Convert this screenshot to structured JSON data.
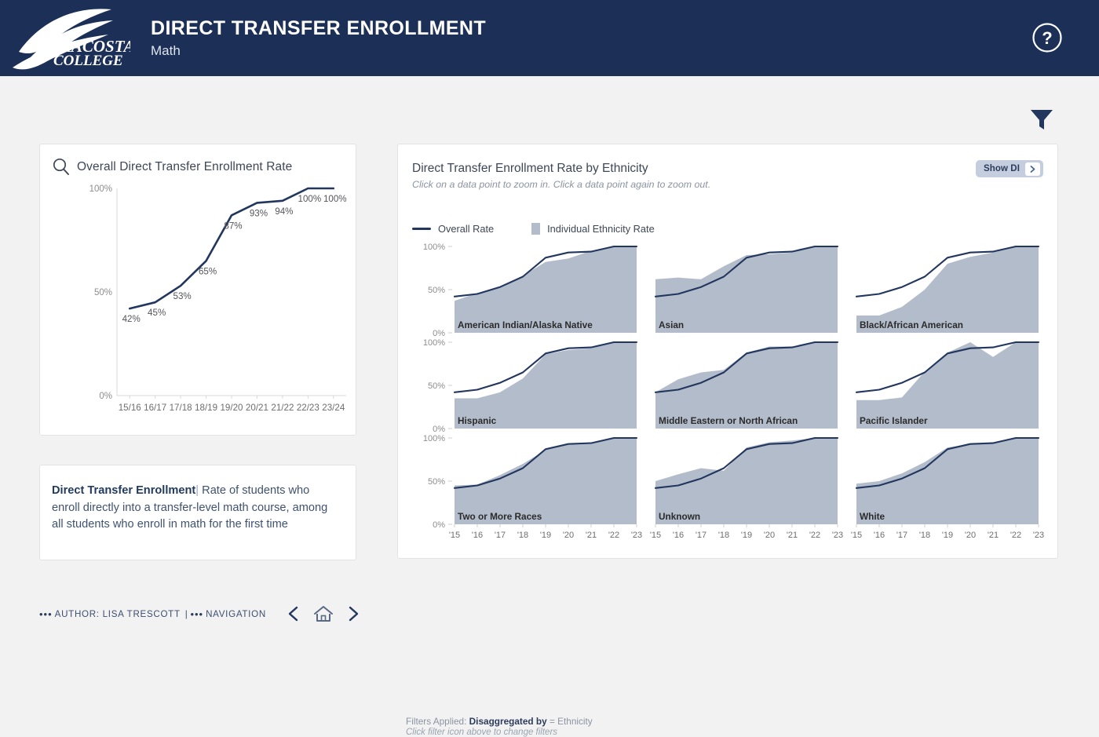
{
  "header": {
    "logo_text_line1": "MIRACOSTA",
    "logo_text_line2": "COLLEGE",
    "title": "DIRECT TRANSFER ENROLLMENT",
    "subtitle": "Math",
    "help_icon": "help-circle-icon",
    "bg_color": "#1b2f57"
  },
  "toolbar": {
    "filter_icon": "filter-funnel-icon"
  },
  "overall_card": {
    "search_icon": "magnifier-icon",
    "title": "Overall Direct Transfer Enrollment Rate"
  },
  "description": {
    "bold": "Direct Transfer Enrollment",
    "pipe": "|",
    "text": "Rate of students who enroll directly into a transfer-level math course, among all students who enroll in math for the first time"
  },
  "ethnicity_card": {
    "title": "Direct Transfer Enrollment Rate by Ethnicity",
    "subtitle": "Click on a data point to zoom in. Click a data point again to zoom out.",
    "show_di_label": "Show DI",
    "show_di_icon": "chevron-right-icon",
    "legend": [
      {
        "type": "line",
        "label": "Overall Rate",
        "color": "#22365e"
      },
      {
        "type": "area",
        "label": "Individual Ethnicity Rate",
        "color": "#b3bcca"
      }
    ],
    "filters_label": "Filters Applied:",
    "filters_key": "Disaggregated by",
    "filters_eq": "=",
    "filters_value": "Ethnicity",
    "filters_hint": "Click filter icon above to change filters"
  },
  "footer": {
    "author": "AUTHOR: LISA TRESCOTT",
    "separator": "|",
    "navigation": "NAVIGATION",
    "prev_icon": "chevron-left-icon",
    "home_icon": "home-icon",
    "next_icon": "chevron-right-icon"
  },
  "chart_data": [
    {
      "type": "line",
      "id": "overall",
      "title": "Overall Direct Transfer Enrollment Rate",
      "xlabel": "",
      "ylabel": "",
      "ylim": [
        0,
        100
      ],
      "yticks": [
        "0%",
        "50%",
        "100%"
      ],
      "ytick_values": [
        0,
        50,
        100
      ],
      "categories": [
        "15/16",
        "16/17",
        "17/18",
        "18/19",
        "19/20",
        "20/21",
        "21/22",
        "22/23",
        "23/24"
      ],
      "values": [
        42,
        45,
        53,
        65,
        87,
        93,
        94,
        100,
        100
      ],
      "data_labels": [
        "42%",
        "45%",
        "53%",
        "65%",
        "87%",
        "93%",
        "94%",
        "100%",
        "100%"
      ],
      "line_color": "#22365e",
      "grid": false,
      "legend": "none"
    },
    {
      "type": "area",
      "id": "by_ethnicity_small_multiples",
      "title": "Direct Transfer Enrollment Rate by Ethnicity",
      "subtitle": "Click on a data point to zoom in. Click a data point again to zoom out.",
      "xlabel": "",
      "ylabel": "",
      "ylim": [
        0,
        100
      ],
      "yticks": [
        "0%",
        "50%",
        "100%"
      ],
      "ytick_values": [
        0,
        50,
        100
      ],
      "x": [
        "'15",
        "'16",
        "'17",
        "'18",
        "'19",
        "'20",
        "'21",
        "'22",
        "'23"
      ],
      "grid": false,
      "legend_position": "top-left",
      "overall_series": {
        "name": "Overall Rate",
        "color": "#22365e",
        "values": [
          42,
          45,
          53,
          65,
          87,
          93,
          94,
          100,
          100
        ]
      },
      "area_color": "#b3bcca",
      "panels": [
        {
          "label": "American Indian/Alaska Native",
          "values": [
            37,
            46,
            52,
            66,
            82,
            86,
            95,
            100,
            100
          ]
        },
        {
          "label": "Asian",
          "values": [
            62,
            64,
            62,
            77,
            90,
            91,
            93,
            100,
            100
          ]
        },
        {
          "label": "Black/African American",
          "values": [
            20,
            20,
            30,
            50,
            80,
            88,
            93,
            100,
            100
          ]
        },
        {
          "label": "Hispanic",
          "values": [
            35,
            35,
            42,
            58,
            86,
            91,
            93,
            100,
            100
          ]
        },
        {
          "label": "Middle Eastern or North African",
          "values": [
            42,
            57,
            65,
            68,
            88,
            95,
            95,
            100,
            100
          ]
        },
        {
          "label": "Pacific Islander",
          "values": [
            33,
            33,
            36,
            66,
            88,
            100,
            83,
            100,
            100
          ]
        },
        {
          "label": "Two or More Races",
          "values": [
            45,
            46,
            57,
            70,
            86,
            92,
            93,
            100,
            100
          ]
        },
        {
          "label": "Unknown",
          "values": [
            50,
            58,
            65,
            62,
            89,
            95,
            97,
            100,
            100
          ]
        },
        {
          "label": "White",
          "values": [
            47,
            50,
            59,
            72,
            89,
            93,
            95,
            100,
            100
          ]
        }
      ]
    }
  ]
}
